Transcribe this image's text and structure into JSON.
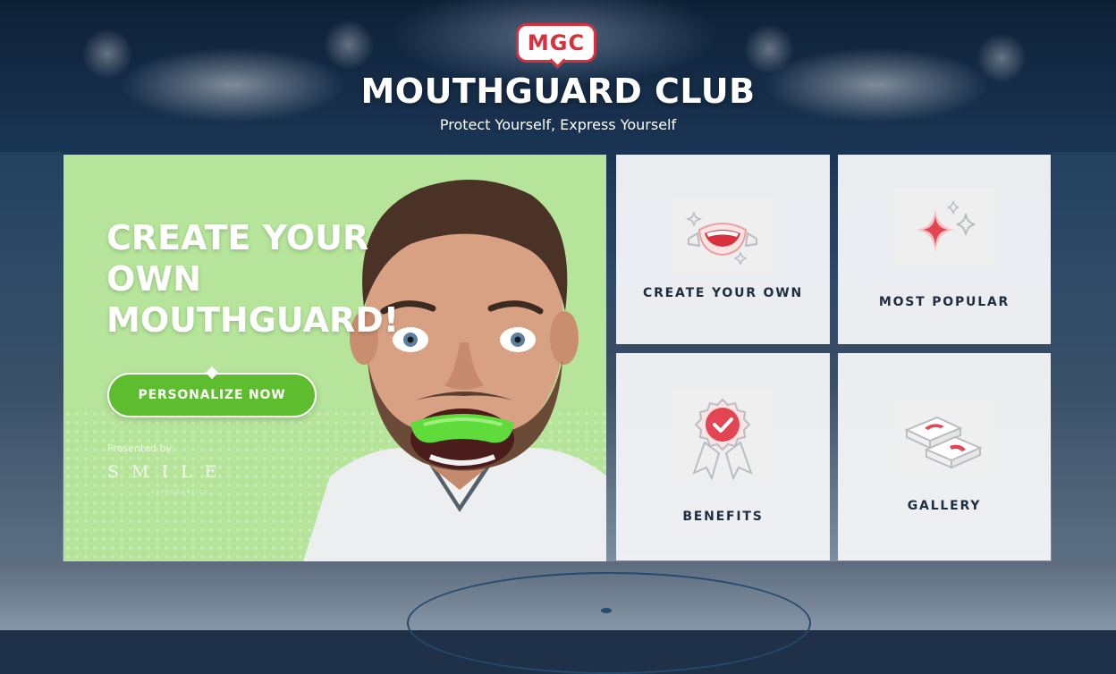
{
  "header": {
    "logo_text": "MGC",
    "title": "MOUTHGUARD CLUB",
    "tagline": "Protect Yourself, Express Yourself"
  },
  "hero": {
    "heading_lines": [
      "CREATE YOUR",
      "OWN",
      "MOUTHGUARD!"
    ],
    "cta_label": "PERSONALIZE NOW",
    "presented_by": "Presented by:",
    "sponsor_name": "SMILE",
    "sponsor_subtitle": "ORTHODONTICS",
    "background_color": "#b5e49a",
    "cta_color": "#5dbd2e"
  },
  "tiles": [
    {
      "label": "CREATE YOUR OWN",
      "icon": "smile-mouthguard-icon"
    },
    {
      "label": "MOST POPULAR",
      "icon": "sparkle-star-icon"
    },
    {
      "label": "BENEFITS",
      "icon": "award-badge-icon"
    },
    {
      "label": "GALLERY",
      "icon": "mouthguard-boxes-icon"
    }
  ],
  "colors": {
    "brand_red": "#d8303d",
    "text_dark": "#1f2e3f"
  }
}
